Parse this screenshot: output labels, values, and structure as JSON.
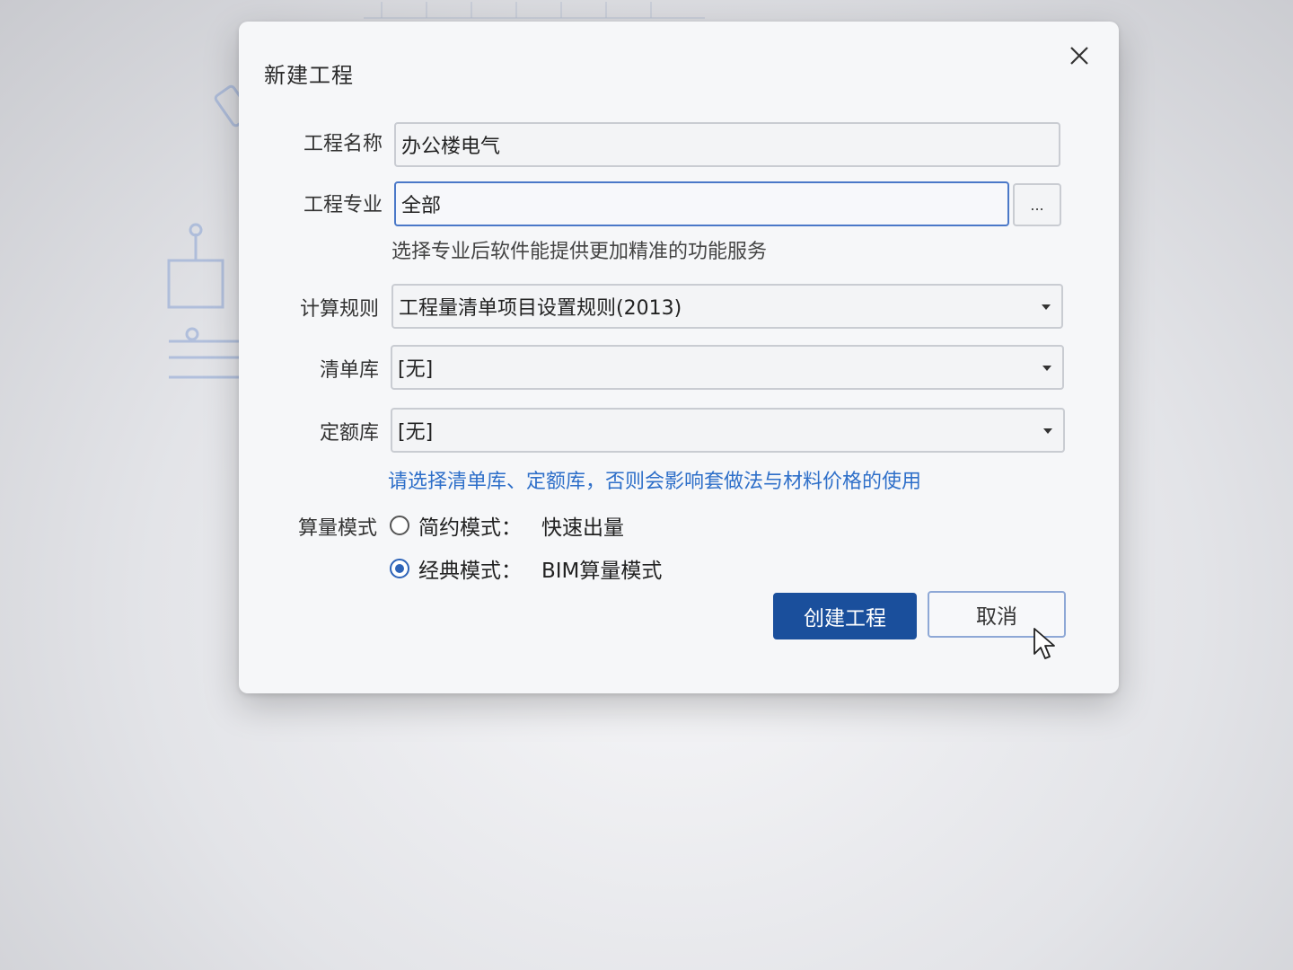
{
  "dialog": {
    "title": "新建工程",
    "close_icon": "close-icon"
  },
  "form": {
    "project_name": {
      "label": "工程名称",
      "value": "办公楼电气"
    },
    "project_discipline": {
      "label": "工程专业",
      "value": "全部",
      "browse_label": "...",
      "hint": "选择专业后软件能提供更加精准的功能服务"
    },
    "calc_rule": {
      "label": "计算规则",
      "value": "工程量清单项目设置规则(2013)"
    },
    "bill_library": {
      "label": "清单库",
      "value": "[无]"
    },
    "quota_library": {
      "label": "定额库",
      "value": "[无]"
    },
    "library_hint": "请选择清单库、定额库，否则会影响套做法与材料价格的使用",
    "calc_mode": {
      "label": "算量模式",
      "options": [
        {
          "label": "简约模式：",
          "desc": "快速出量",
          "checked": false
        },
        {
          "label": "经典模式：",
          "desc": "BIM算量模式",
          "checked": true
        }
      ]
    }
  },
  "buttons": {
    "create": "创建工程",
    "cancel": "取消"
  },
  "colors": {
    "primary": "#1a4f9c",
    "hint_blue": "#2e6fc9",
    "focus_border": "#4a78c8"
  }
}
